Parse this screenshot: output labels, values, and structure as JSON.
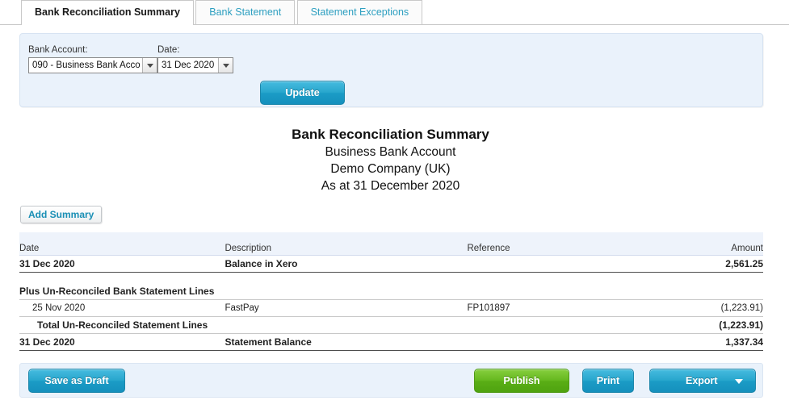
{
  "tabs": [
    {
      "label": "Bank Reconciliation Summary",
      "active": true
    },
    {
      "label": "Bank Statement",
      "active": false
    },
    {
      "label": "Statement Exceptions",
      "active": false
    }
  ],
  "filter": {
    "bank_account_label": "Bank Account:",
    "bank_account_value": "090 - Business Bank Acco",
    "date_label": "Date:",
    "date_value": "31 Dec 2020",
    "update_label": "Update"
  },
  "report": {
    "title": "Bank Reconciliation Summary",
    "subtitle_account": "Business Bank Account",
    "subtitle_company": "Demo Company (UK)",
    "subtitle_date": "As at 31 December 2020",
    "add_summary_label": "Add Summary",
    "columns": {
      "date": "Date",
      "description": "Description",
      "reference": "Reference",
      "amount": "Amount"
    },
    "rows": [
      {
        "date": "31 Dec 2020",
        "description": "Balance in Xero",
        "reference": "",
        "amount": "2,561.25"
      },
      {
        "date": "Plus Un-Reconciled Bank Statement Lines",
        "description": "",
        "reference": "",
        "amount": ""
      },
      {
        "date": "25 Nov 2020",
        "description": "FastPay",
        "reference": "FP101897",
        "amount": "(1,223.91)"
      },
      {
        "date": "Total Un-Reconciled Statement Lines",
        "description": "",
        "reference": "",
        "amount": "(1,223.91)"
      },
      {
        "date": "31 Dec 2020",
        "description": "Statement Balance",
        "reference": "",
        "amount": "1,337.34"
      }
    ]
  },
  "footer": {
    "save_draft_label": "Save as Draft",
    "publish_label": "Publish",
    "print_label": "Print",
    "export_label": "Export"
  },
  "colors": {
    "accent_blue": "#1b9cc6",
    "accent_green": "#5aae16",
    "tab_link": "#2d9fc0",
    "panel_bg": "#eaf2fb",
    "table_header_bg": "#eef3fb"
  }
}
